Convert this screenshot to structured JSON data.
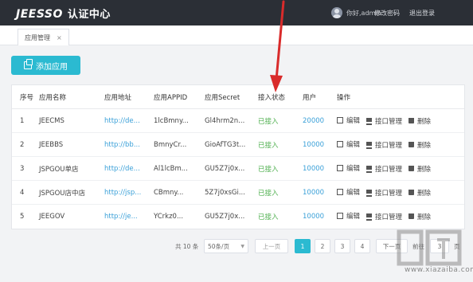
{
  "header": {
    "brand": "JEESSO",
    "subtitle": "认证中心",
    "greeting": "你好,admin",
    "change_password": "修改密码",
    "logout": "退出登录"
  },
  "tabs": [
    {
      "label": "应用管理",
      "close": "×"
    }
  ],
  "toolbar": {
    "add_label": "添加应用"
  },
  "table": {
    "columns": [
      "序号",
      "应用名称",
      "应用地址",
      "应用APPID",
      "应用Secret",
      "接入状态",
      "用户",
      "操作"
    ],
    "rows": [
      {
        "no": "1",
        "name": "JEECMS",
        "url": "http://de...",
        "appid": "1lcBmny...",
        "secret": "Gl4hrm2n...",
        "status": "已接入",
        "users": "20000"
      },
      {
        "no": "2",
        "name": "JEEBBS",
        "url": "http://bb...",
        "appid": "BmnyCr...",
        "secret": "GioAfTG3t...",
        "status": "已接入",
        "users": "10000"
      },
      {
        "no": "3",
        "name": "JSPGOU单店",
        "url": "http://de...",
        "appid": "Al1lcBm...",
        "secret": "GU5Z7j0x...",
        "status": "已接入",
        "users": "10000"
      },
      {
        "no": "4",
        "name": "JSPGOU店中店",
        "url": "http://jsp...",
        "appid": "CBmny...",
        "secret": "5Z7j0xsGi...",
        "status": "已接入",
        "users": "10000"
      },
      {
        "no": "5",
        "name": "JEEGOV",
        "url": "http://je...",
        "appid": "YCrkz0...",
        "secret": "GU5Z7j0x...",
        "status": "已接入",
        "users": "10000"
      }
    ],
    "actions": {
      "edit": "编辑",
      "api": "接口管理",
      "delete": "删除"
    }
  },
  "pagination": {
    "total": "共 10 条",
    "page_size": "50条/页",
    "prev": "上一页",
    "pages": [
      "1",
      "2",
      "3",
      "4"
    ],
    "current": "1",
    "next": "下一页",
    "goto": "前往",
    "goto_value": "3",
    "page_unit": "页"
  },
  "watermark": {
    "text": "www.xiazaiba.com"
  },
  "colors": {
    "accent": "#2bbad1",
    "link": "#3aa0d8",
    "status_ok": "#4cae4c",
    "arrow": "#d92b2b"
  }
}
